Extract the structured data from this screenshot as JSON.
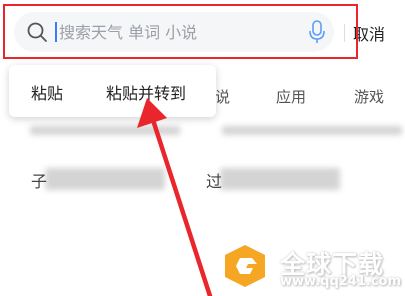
{
  "search": {
    "placeholder": "搜索天气 单词 小说",
    "value": "",
    "cancel_label": "取消"
  },
  "popup": {
    "items": [
      {
        "label": "粘贴"
      },
      {
        "label": "粘贴并转到"
      }
    ]
  },
  "tabs": [
    {
      "label": "说"
    },
    {
      "label": "应用"
    },
    {
      "label": "游戏"
    }
  ],
  "content_fragments": [
    "子",
    "过"
  ],
  "watermark": {
    "text": "全球下载",
    "url": "www.qq241.com"
  },
  "colors": {
    "highlight_red": "#e8262b",
    "caret_blue": "#3a7bfd",
    "mic_blue": "#5b9cf5",
    "logo_orange": "#f5a623"
  },
  "icons": {
    "search": "search-icon",
    "mic": "mic-icon",
    "logo": "watermark-logo-icon"
  }
}
